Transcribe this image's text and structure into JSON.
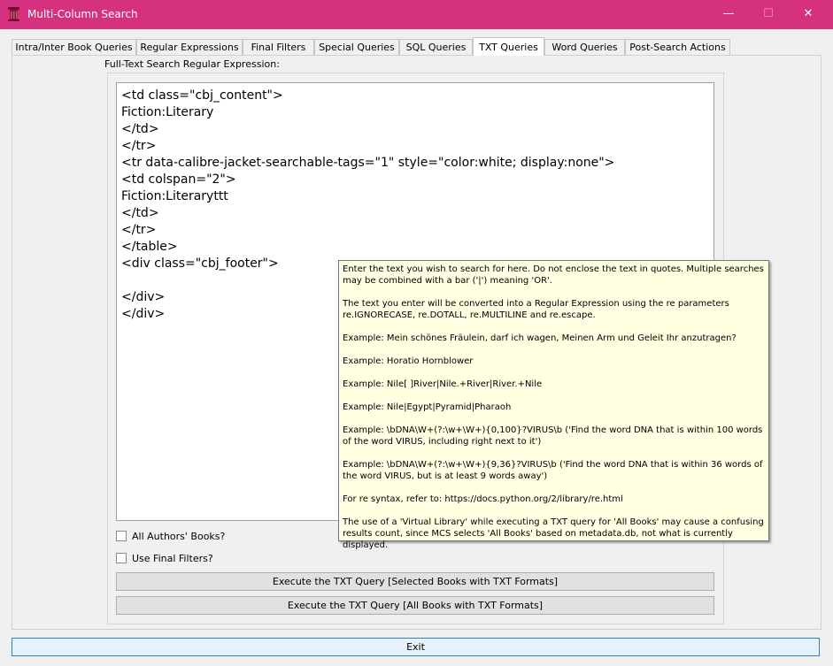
{
  "window": {
    "title": "Multi-Column Search",
    "controls": {
      "minimize": "—",
      "maximize": "☐",
      "close": "✕"
    },
    "accent": "#d6317f"
  },
  "tabs": [
    {
      "label": "Intra/Inter Book Queries",
      "active": false
    },
    {
      "label": "Regular Expressions",
      "active": false
    },
    {
      "label": "Final Filters",
      "active": false
    },
    {
      "label": "Special Queries",
      "active": false
    },
    {
      "label": "SQL Queries",
      "active": false
    },
    {
      "label": "TXT Queries",
      "active": true
    },
    {
      "label": "Word Queries",
      "active": false
    },
    {
      "label": "Post-Search Actions",
      "active": false
    }
  ],
  "txt_query": {
    "field_label": "Full-Text Search Regular Expression:",
    "editor_lines": [
      "<td class=\"cbj_content\">",
      "Fiction:Literary",
      "</td>",
      "</tr>",
      "<tr data-calibre-jacket-searchable-tags=\"1\" style=\"color:white; display:none\">",
      "<td colspan=\"2\">",
      "Fiction:Literaryttt",
      "</td>",
      "</tr>",
      "</table>",
      "<div class=\"cbj_footer\">",
      "",
      "</div>",
      "</div>"
    ],
    "all_authors_label": "All Authors' Books?",
    "all_authors_checked": false,
    "use_final_filters_label": "Use Final Filters?",
    "use_final_filters_checked": false,
    "execute_selected_label": "Execute the TXT Query [Selected Books with TXT Formats]",
    "execute_all_label": "Execute the TXT Query [All Books with TXT Formats]"
  },
  "tooltip": {
    "paragraphs": [
      "Enter the text you wish to search for here. Do not enclose the text in quotes. Multiple searches may be combined with a bar ('|') meaning 'OR'.",
      "The text you enter will be converted into a Regular Expression using the re parameters re.IGNORECASE, re.DOTALL, re.MULTILINE and re.escape.",
      "Example: Mein schönes Fräulein, darf ich wagen, Meinen Arm und Geleit Ihr anzutragen?",
      "Example: Horatio Hornblower",
      "Example: Nile[ ]River|Nile.+River|River.+Nile",
      "Example: Nile|Egypt|Pyramid|Pharaoh",
      "Example: \\bDNA\\W+(?:\\w+\\W+){0,100}?VIRUS\\b ('Find the word DNA that is within 100 words of the word VIRUS, including right next to it')",
      "Example: \\bDNA\\W+(?:\\w+\\W+){9,36}?VIRUS\\b ('Find the word DNA that is within 36 words of the word VIRUS, but is at least 9 words away')",
      "For re syntax, refer to: https://docs.python.org/2/library/re.html",
      "The use of a 'Virtual Library' while executing a TXT query for 'All Books' may cause a confusing results count, since MCS selects 'All Books' based on metadata.db, not what is currently displayed."
    ]
  },
  "footer": {
    "exit_label": "Exit"
  }
}
